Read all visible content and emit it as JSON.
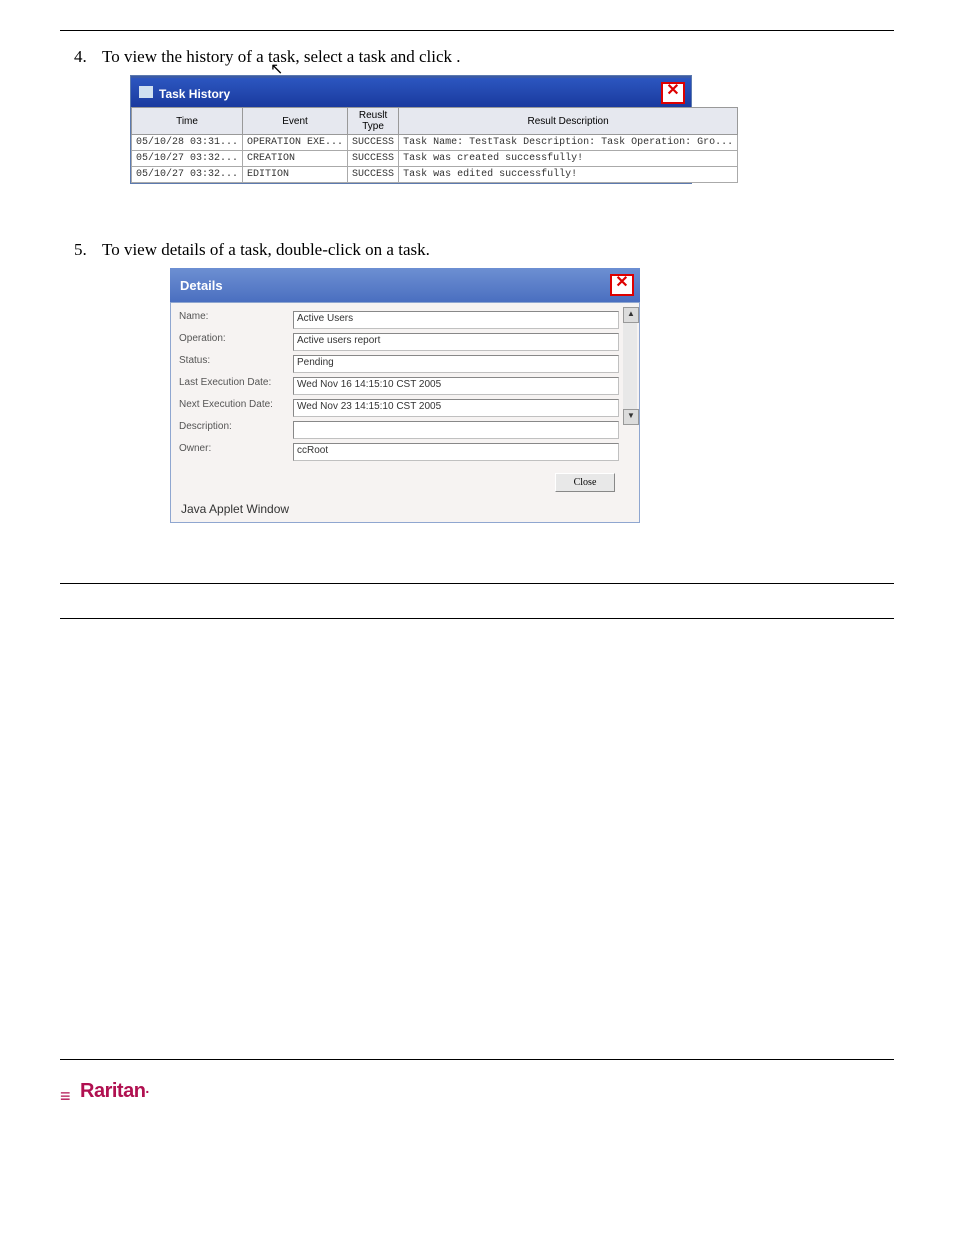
{
  "steps": [
    {
      "num": "4.",
      "text": "To view the history of a task, select a task and click                           ."
    },
    {
      "num": "5.",
      "text": "To view details of a task, double-click on a task."
    }
  ],
  "history": {
    "title": "Task History",
    "cols": [
      "Time",
      "Event",
      "Reuslt Type",
      "Result Description"
    ],
    "rows": [
      [
        "05/10/28 03:31...",
        "OPERATION EXE...",
        "SUCCESS",
        "Task Name: TestTask Description: Task Operation: Gro..."
      ],
      [
        "05/10/27 03:32...",
        "CREATION",
        "SUCCESS",
        "Task was created successfully!"
      ],
      [
        "05/10/27 03:32...",
        "EDITION",
        "SUCCESS",
        "Task was edited successfully!"
      ]
    ]
  },
  "details": {
    "title": "Details",
    "fields": [
      {
        "label": "Name:",
        "value": "Active Users"
      },
      {
        "label": "Operation:",
        "value": "Active users report"
      },
      {
        "label": "Status:",
        "value": "Pending"
      },
      {
        "label": "Last Execution Date:",
        "value": "Wed Nov 16 14:15:10 CST 2005"
      },
      {
        "label": "Next Execution Date:",
        "value": "Wed Nov 23 14:15:10 CST 2005"
      },
      {
        "label": "Description:",
        "value": ""
      },
      {
        "label": "Owner:",
        "value": "ccRoot"
      }
    ],
    "close": "Close",
    "javawin": "Java Applet Window"
  },
  "footer": {
    "logo": "Raritan"
  }
}
